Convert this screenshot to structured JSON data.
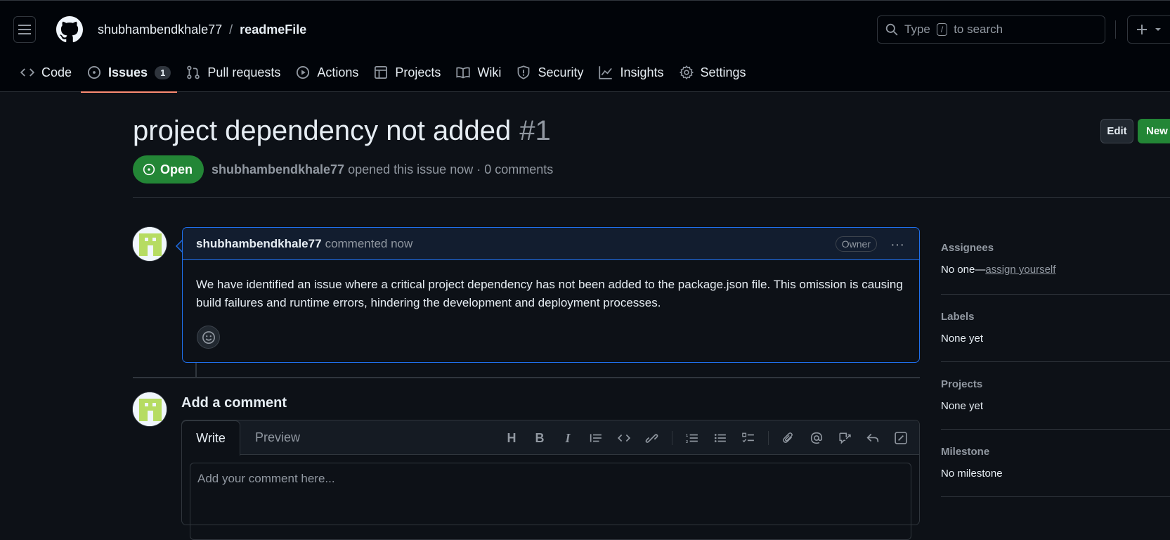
{
  "header": {
    "owner": "shubhambendkhale77",
    "separator": "/",
    "repo": "readmeFile",
    "search": {
      "prefix": "Type",
      "key": "/",
      "suffix": "to search"
    },
    "plus_label": "+"
  },
  "tabs": [
    {
      "label": "Code",
      "icon": "code-icon"
    },
    {
      "label": "Issues",
      "icon": "issue-opened-icon",
      "count": "1"
    },
    {
      "label": "Pull requests",
      "icon": "git-pull-request-icon"
    },
    {
      "label": "Actions",
      "icon": "play-icon"
    },
    {
      "label": "Projects",
      "icon": "table-icon"
    },
    {
      "label": "Wiki",
      "icon": "book-icon"
    },
    {
      "label": "Security",
      "icon": "shield-icon"
    },
    {
      "label": "Insights",
      "icon": "graph-icon"
    },
    {
      "label": "Settings",
      "icon": "gear-icon"
    }
  ],
  "issue": {
    "title": "project dependency not added",
    "number": "#1",
    "edit_label": "Edit",
    "new_label": "New",
    "state": "Open",
    "author": "shubhambendkhale77",
    "meta": "opened this issue now · 0 comments"
  },
  "comment": {
    "author": "shubhambendkhale77",
    "action": "commented now",
    "role": "Owner",
    "body": "We have identified an issue where a critical project dependency has not been added to the package.json file. This omission is causing build failures and runtime errors, hindering the development and deployment processes."
  },
  "composer": {
    "title": "Add a comment",
    "write_tab": "Write",
    "preview_tab": "Preview",
    "placeholder": "Add your comment here..."
  },
  "sidebar": {
    "assignees": {
      "label": "Assignees",
      "value": "No one—",
      "link": "assign yourself"
    },
    "labels": {
      "label": "Labels",
      "value": "None yet"
    },
    "projects": {
      "label": "Projects",
      "value": "None yet"
    },
    "milestone": {
      "label": "Milestone",
      "value": "No milestone"
    }
  },
  "colors": {
    "accent": "#fd8c73",
    "open": "#238636",
    "link_border": "#1f6feb"
  }
}
